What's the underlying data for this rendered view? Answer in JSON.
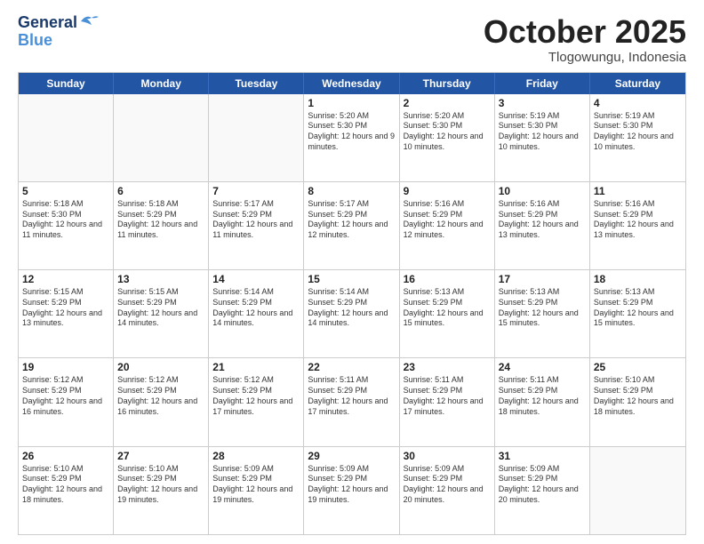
{
  "logo": {
    "line1": "General",
    "line2": "Blue"
  },
  "title": "October 2025",
  "location": "Tlogowungu, Indonesia",
  "header_days": [
    "Sunday",
    "Monday",
    "Tuesday",
    "Wednesday",
    "Thursday",
    "Friday",
    "Saturday"
  ],
  "rows": [
    [
      {
        "day": "",
        "text": "",
        "empty": true
      },
      {
        "day": "",
        "text": "",
        "empty": true
      },
      {
        "day": "",
        "text": "",
        "empty": true
      },
      {
        "day": "1",
        "text": "Sunrise: 5:20 AM\nSunset: 5:30 PM\nDaylight: 12 hours\nand 9 minutes.",
        "empty": false
      },
      {
        "day": "2",
        "text": "Sunrise: 5:20 AM\nSunset: 5:30 PM\nDaylight: 12 hours\nand 10 minutes.",
        "empty": false
      },
      {
        "day": "3",
        "text": "Sunrise: 5:19 AM\nSunset: 5:30 PM\nDaylight: 12 hours\nand 10 minutes.",
        "empty": false
      },
      {
        "day": "4",
        "text": "Sunrise: 5:19 AM\nSunset: 5:30 PM\nDaylight: 12 hours\nand 10 minutes.",
        "empty": false
      }
    ],
    [
      {
        "day": "5",
        "text": "Sunrise: 5:18 AM\nSunset: 5:30 PM\nDaylight: 12 hours\nand 11 minutes.",
        "empty": false
      },
      {
        "day": "6",
        "text": "Sunrise: 5:18 AM\nSunset: 5:29 PM\nDaylight: 12 hours\nand 11 minutes.",
        "empty": false
      },
      {
        "day": "7",
        "text": "Sunrise: 5:17 AM\nSunset: 5:29 PM\nDaylight: 12 hours\nand 11 minutes.",
        "empty": false
      },
      {
        "day": "8",
        "text": "Sunrise: 5:17 AM\nSunset: 5:29 PM\nDaylight: 12 hours\nand 12 minutes.",
        "empty": false
      },
      {
        "day": "9",
        "text": "Sunrise: 5:16 AM\nSunset: 5:29 PM\nDaylight: 12 hours\nand 12 minutes.",
        "empty": false
      },
      {
        "day": "10",
        "text": "Sunrise: 5:16 AM\nSunset: 5:29 PM\nDaylight: 12 hours\nand 13 minutes.",
        "empty": false
      },
      {
        "day": "11",
        "text": "Sunrise: 5:16 AM\nSunset: 5:29 PM\nDaylight: 12 hours\nand 13 minutes.",
        "empty": false
      }
    ],
    [
      {
        "day": "12",
        "text": "Sunrise: 5:15 AM\nSunset: 5:29 PM\nDaylight: 12 hours\nand 13 minutes.",
        "empty": false
      },
      {
        "day": "13",
        "text": "Sunrise: 5:15 AM\nSunset: 5:29 PM\nDaylight: 12 hours\nand 14 minutes.",
        "empty": false
      },
      {
        "day": "14",
        "text": "Sunrise: 5:14 AM\nSunset: 5:29 PM\nDaylight: 12 hours\nand 14 minutes.",
        "empty": false
      },
      {
        "day": "15",
        "text": "Sunrise: 5:14 AM\nSunset: 5:29 PM\nDaylight: 12 hours\nand 14 minutes.",
        "empty": false
      },
      {
        "day": "16",
        "text": "Sunrise: 5:13 AM\nSunset: 5:29 PM\nDaylight: 12 hours\nand 15 minutes.",
        "empty": false
      },
      {
        "day": "17",
        "text": "Sunrise: 5:13 AM\nSunset: 5:29 PM\nDaylight: 12 hours\nand 15 minutes.",
        "empty": false
      },
      {
        "day": "18",
        "text": "Sunrise: 5:13 AM\nSunset: 5:29 PM\nDaylight: 12 hours\nand 15 minutes.",
        "empty": false
      }
    ],
    [
      {
        "day": "19",
        "text": "Sunrise: 5:12 AM\nSunset: 5:29 PM\nDaylight: 12 hours\nand 16 minutes.",
        "empty": false
      },
      {
        "day": "20",
        "text": "Sunrise: 5:12 AM\nSunset: 5:29 PM\nDaylight: 12 hours\nand 16 minutes.",
        "empty": false
      },
      {
        "day": "21",
        "text": "Sunrise: 5:12 AM\nSunset: 5:29 PM\nDaylight: 12 hours\nand 17 minutes.",
        "empty": false
      },
      {
        "day": "22",
        "text": "Sunrise: 5:11 AM\nSunset: 5:29 PM\nDaylight: 12 hours\nand 17 minutes.",
        "empty": false
      },
      {
        "day": "23",
        "text": "Sunrise: 5:11 AM\nSunset: 5:29 PM\nDaylight: 12 hours\nand 17 minutes.",
        "empty": false
      },
      {
        "day": "24",
        "text": "Sunrise: 5:11 AM\nSunset: 5:29 PM\nDaylight: 12 hours\nand 18 minutes.",
        "empty": false
      },
      {
        "day": "25",
        "text": "Sunrise: 5:10 AM\nSunset: 5:29 PM\nDaylight: 12 hours\nand 18 minutes.",
        "empty": false
      }
    ],
    [
      {
        "day": "26",
        "text": "Sunrise: 5:10 AM\nSunset: 5:29 PM\nDaylight: 12 hours\nand 18 minutes.",
        "empty": false
      },
      {
        "day": "27",
        "text": "Sunrise: 5:10 AM\nSunset: 5:29 PM\nDaylight: 12 hours\nand 19 minutes.",
        "empty": false
      },
      {
        "day": "28",
        "text": "Sunrise: 5:09 AM\nSunset: 5:29 PM\nDaylight: 12 hours\nand 19 minutes.",
        "empty": false
      },
      {
        "day": "29",
        "text": "Sunrise: 5:09 AM\nSunset: 5:29 PM\nDaylight: 12 hours\nand 19 minutes.",
        "empty": false
      },
      {
        "day": "30",
        "text": "Sunrise: 5:09 AM\nSunset: 5:29 PM\nDaylight: 12 hours\nand 20 minutes.",
        "empty": false
      },
      {
        "day": "31",
        "text": "Sunrise: 5:09 AM\nSunset: 5:29 PM\nDaylight: 12 hours\nand 20 minutes.",
        "empty": false
      },
      {
        "day": "",
        "text": "",
        "empty": true
      }
    ]
  ]
}
